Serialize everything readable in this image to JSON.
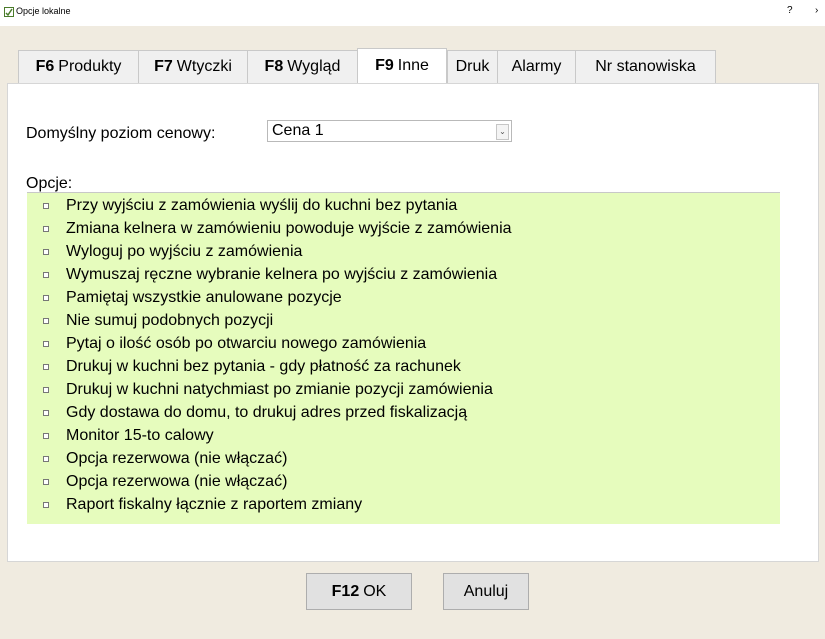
{
  "window": {
    "title": "Opcje lokalne",
    "help": "?",
    "close": "›"
  },
  "tabs": [
    {
      "key": "F6",
      "label": "Produkty",
      "width": 120
    },
    {
      "key": "F7",
      "label": "Wtyczki",
      "width": 109
    },
    {
      "key": "F8",
      "label": "Wygląd",
      "width": 110
    },
    {
      "key": "F9",
      "label": "Inne",
      "width": 90,
      "active": true
    },
    {
      "key": "",
      "label": "Druk",
      "width": 50
    },
    {
      "key": "",
      "label": "Alarmy",
      "width": 78
    },
    {
      "key": "",
      "label": "Nr stanowiska",
      "width": 141
    }
  ],
  "price": {
    "label": "Domyślny poziom cenowy:",
    "value": "Cena 1"
  },
  "options": {
    "label": "Opcje:",
    "items": [
      {
        "text": "Przy wyjściu z zamówienia wyślij do kuchni bez pytania",
        "checked": false
      },
      {
        "text": "Zmiana kelnera w zamówieniu powoduje wyjście z zamówienia",
        "checked": false
      },
      {
        "text": "Wyloguj po wyjściu z zamówienia",
        "checked": false
      },
      {
        "text": "Wymuszaj ręczne wybranie kelnera po wyjściu z zamówienia",
        "checked": false
      },
      {
        "text": "Pamiętaj wszystkie anulowane pozycje",
        "checked": false
      },
      {
        "text": "Nie sumuj podobnych pozycji",
        "checked": false
      },
      {
        "text": "Pytaj o ilość osób po otwarciu nowego zamówienia",
        "checked": false
      },
      {
        "text": "Drukuj w kuchni bez pytania - gdy płatność za rachunek",
        "checked": false
      },
      {
        "text": "Drukuj w kuchni natychmiast po zmianie pozycji zamówienia",
        "checked": false
      },
      {
        "text": "Gdy dostawa do domu, to drukuj adres przed fiskalizacją",
        "checked": false
      },
      {
        "text": "Monitor 15-to calowy",
        "checked": false
      },
      {
        "text": "Opcja rezerwowa (nie włączać)",
        "checked": false
      },
      {
        "text": "Opcja rezerwowa (nie włączać)",
        "checked": false
      },
      {
        "text": "Raport fiskalny łącznie z raportem zmiany",
        "checked": false
      }
    ]
  },
  "buttons": {
    "ok_key": "F12",
    "ok_label": "OK",
    "cancel_label": "Anuluj"
  },
  "colors": {
    "list_bg": "#e6fcbd",
    "dialog_bg": "#f0ebe0"
  }
}
